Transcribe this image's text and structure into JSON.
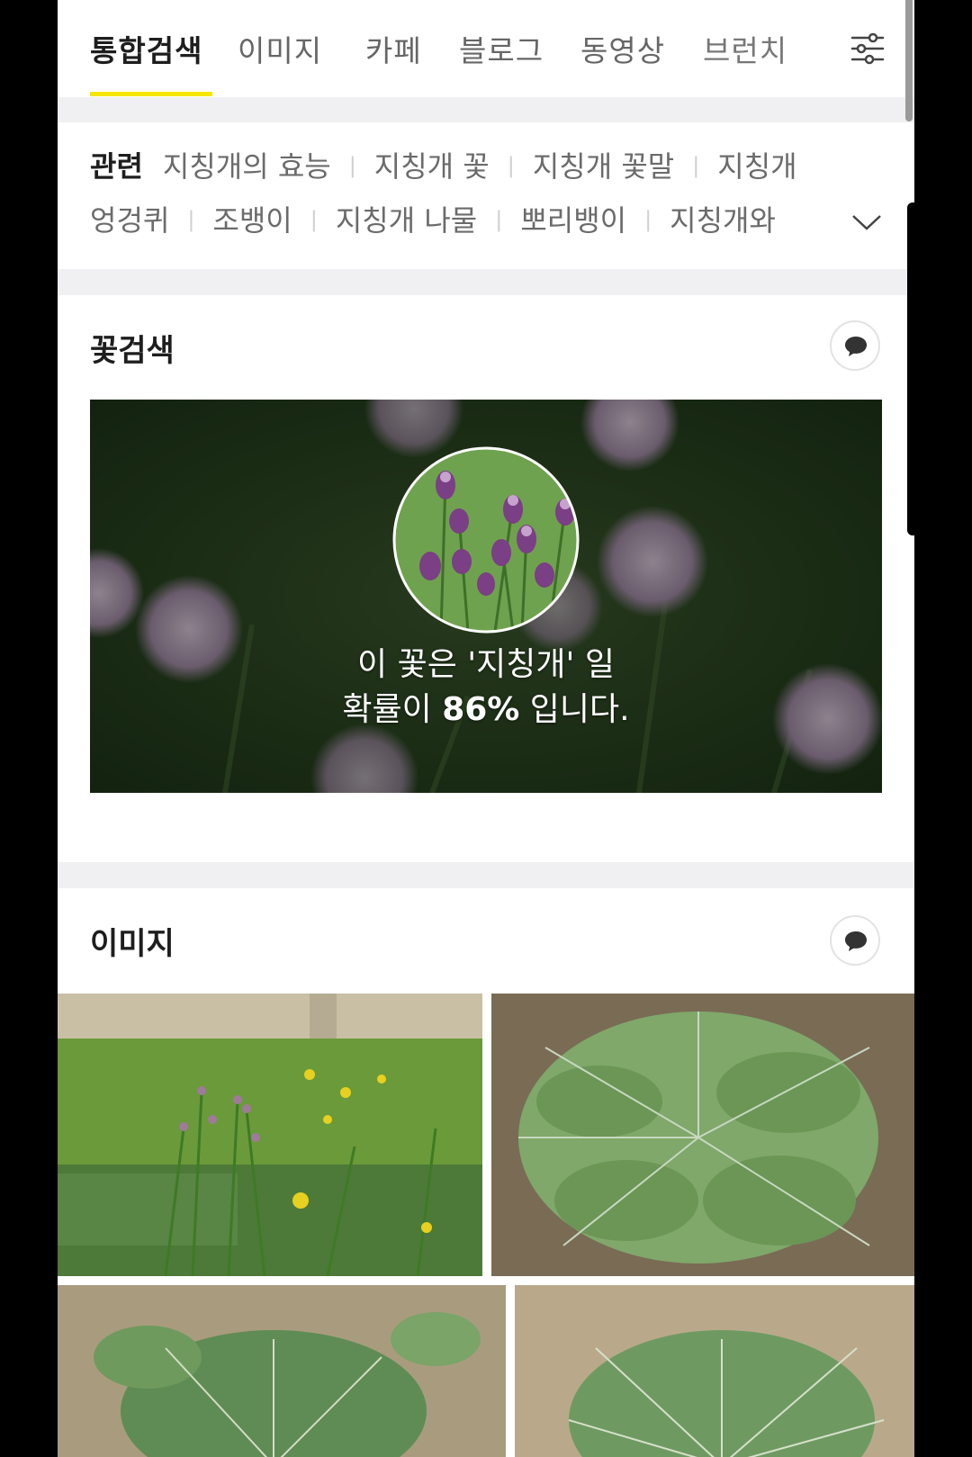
{
  "tabs": [
    "통합검색",
    "이미지",
    "카페",
    "블로그",
    "동영상",
    "브런치"
  ],
  "related": {
    "heading": "관련",
    "row1": [
      "지칭개의 효능",
      "지칭개 꽃",
      "지칭개 꽃말",
      "지칭개"
    ],
    "row2": [
      "엉겅퀴",
      "조뱅이",
      "지칭개 나물",
      "뽀리뱅이",
      "지칭개와"
    ]
  },
  "flower_search": {
    "title": "꽃검색",
    "line1": "이 꽃은 '지칭개' 일",
    "line2_prefix": "확률이 ",
    "line2_percent": "86%",
    "line2_suffix": " 입니다."
  },
  "images": {
    "title": "이미지"
  },
  "colors": {
    "accent": "#f7e600",
    "text": "#1e1e1e",
    "muted": "#6b6b6b"
  },
  "icons": [
    "filter-icon",
    "chevron-down-icon",
    "talk-bubble-icon"
  ]
}
